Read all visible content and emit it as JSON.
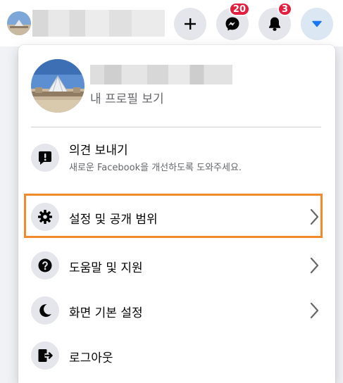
{
  "topbar": {
    "messenger_badge": "20",
    "notifications_badge": "3"
  },
  "menu": {
    "profile_link": "내 프로필 보기",
    "feedback": {
      "title": "의견 보내기",
      "subtitle": "새로운 Facebook을 개선하도록 도와주세요."
    },
    "items": [
      {
        "label": "설정 및 공개 범위",
        "icon": "gear-icon",
        "has_chevron": true,
        "highlighted": true
      },
      {
        "label": "도움말 및 지원",
        "icon": "question-icon",
        "has_chevron": true
      },
      {
        "label": "화면 기본 설정",
        "icon": "moon-icon",
        "has_chevron": true
      },
      {
        "label": "로그아웃",
        "icon": "logout-icon",
        "has_chevron": false
      }
    ]
  },
  "colors": {
    "accent": "#1877f2",
    "badge": "#e41e3f",
    "highlight_border": "#f08a2b",
    "icon_bg": "#e4e6eb"
  }
}
